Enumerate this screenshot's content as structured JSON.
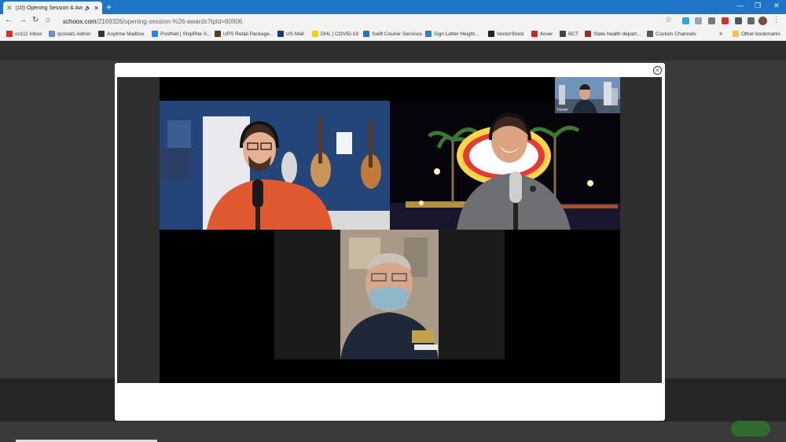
{
  "browser": {
    "tab_title": "(10) Opening Session & Awa",
    "url_host": "schoox.com",
    "url_path": "/2169326/opening-session-%26-awards?tpId=60906",
    "other_bookmarks": "Other bookmarks",
    "bookmarks": [
      {
        "label": "co111 Inbox",
        "color": "#d93025"
      },
      {
        "label": "Ipostal1 Admin",
        "color": "#6b8fc7"
      },
      {
        "label": "Anytime Mailbox",
        "color": "#333333"
      },
      {
        "label": "PostNet | ShipRite S...",
        "color": "#1e88e5"
      },
      {
        "label": "UPS Retail Package...",
        "color": "#5d3a1a"
      },
      {
        "label": "US Mail",
        "color": "#1a3d7c"
      },
      {
        "label": "DHL | COVID-19",
        "color": "#ffcc00"
      },
      {
        "label": "Swift Courier Services",
        "color": "#2a6fb5"
      },
      {
        "label": "Sign Letter Height...",
        "color": "#2f80c3"
      },
      {
        "label": "VectorStock",
        "color": "#222222"
      },
      {
        "label": "4over",
        "color": "#c62828"
      },
      {
        "label": "BCT",
        "color": "#444444"
      },
      {
        "label": "State health depart...",
        "color": "#9c2a2a"
      },
      {
        "label": "Custom Channels",
        "color": "#555555"
      }
    ]
  },
  "modal": {
    "participant_label": "Trevor"
  },
  "colors": {
    "tab_bar": "#1f74c7",
    "page_bg": "#3a3a3a"
  }
}
